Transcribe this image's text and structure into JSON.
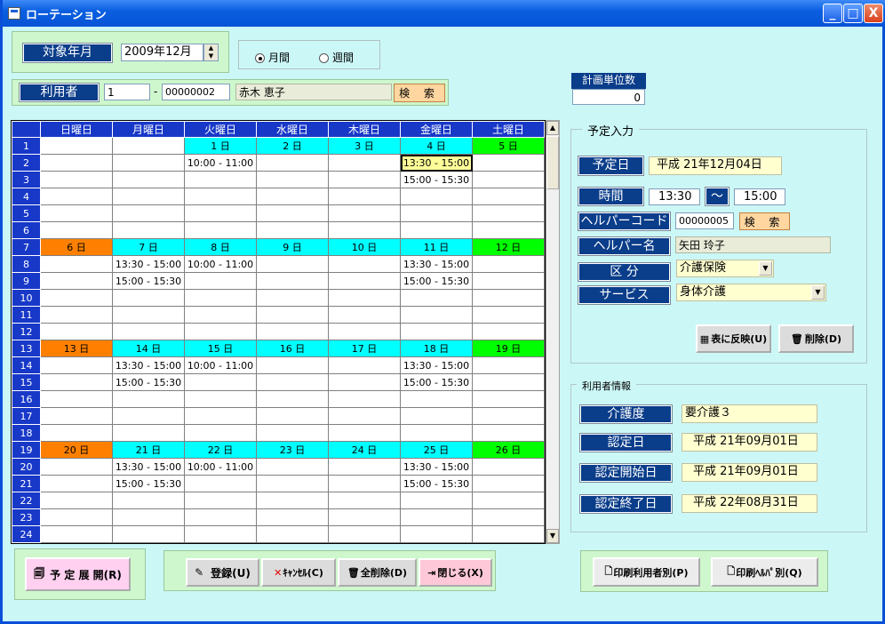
{
  "window": {
    "title": "ローテーション",
    "min": "_",
    "max": "□",
    "close": "X"
  },
  "header": {
    "target_label": "対象年月",
    "target_value": "2009年12月",
    "radio_month": "月間",
    "radio_week": "週間",
    "user_label": "利用者",
    "user_from": "1",
    "user_dash": "-",
    "user_to": "00000002",
    "user_name": "赤木 恵子",
    "search": "検 索",
    "plan_units_label": "計画単位数",
    "plan_units_value": "0"
  },
  "calendar": {
    "days": [
      "日曜日",
      "月曜日",
      "火曜日",
      "水曜日",
      "木曜日",
      "金曜日",
      "土曜日"
    ],
    "rows": [
      {
        "n": "1",
        "type": "date",
        "cells": [
          "",
          "",
          "1 日",
          "2 日",
          "3 日",
          "4 日",
          "5 日"
        ]
      },
      {
        "n": "2",
        "cells": [
          "",
          "",
          "10:00 - 11:00",
          "",
          "",
          "13:30 - 15:00",
          ""
        ]
      },
      {
        "n": "3",
        "cells": [
          "",
          "",
          "",
          "",
          "",
          "15:00 - 15:30",
          ""
        ]
      },
      {
        "n": "4",
        "cells": [
          "",
          "",
          "",
          "",
          "",
          "",
          ""
        ]
      },
      {
        "n": "5",
        "cells": [
          "",
          "",
          "",
          "",
          "",
          "",
          ""
        ]
      },
      {
        "n": "6",
        "cells": [
          "",
          "",
          "",
          "",
          "",
          "",
          ""
        ]
      },
      {
        "n": "7",
        "type": "date",
        "cells": [
          "6 日",
          "7 日",
          "8 日",
          "9 日",
          "10 日",
          "11 日",
          "12 日"
        ]
      },
      {
        "n": "8",
        "cells": [
          "",
          "13:30 - 15:00",
          "10:00 - 11:00",
          "",
          "",
          "13:30 - 15:00",
          ""
        ]
      },
      {
        "n": "9",
        "cells": [
          "",
          "15:00 - 15:30",
          "",
          "",
          "",
          "15:00 - 15:30",
          ""
        ]
      },
      {
        "n": "10",
        "cells": [
          "",
          "",
          "",
          "",
          "",
          "",
          ""
        ]
      },
      {
        "n": "11",
        "cells": [
          "",
          "",
          "",
          "",
          "",
          "",
          ""
        ]
      },
      {
        "n": "12",
        "cells": [
          "",
          "",
          "",
          "",
          "",
          "",
          ""
        ]
      },
      {
        "n": "13",
        "type": "date",
        "cells": [
          "13 日",
          "14 日",
          "15 日",
          "16 日",
          "17 日",
          "18 日",
          "19 日"
        ]
      },
      {
        "n": "14",
        "cells": [
          "",
          "13:30 - 15:00",
          "10:00 - 11:00",
          "",
          "",
          "13:30 - 15:00",
          ""
        ]
      },
      {
        "n": "15",
        "cells": [
          "",
          "15:00 - 15:30",
          "",
          "",
          "",
          "15:00 - 15:30",
          ""
        ]
      },
      {
        "n": "16",
        "cells": [
          "",
          "",
          "",
          "",
          "",
          "",
          ""
        ]
      },
      {
        "n": "17",
        "cells": [
          "",
          "",
          "",
          "",
          "",
          "",
          ""
        ]
      },
      {
        "n": "18",
        "cells": [
          "",
          "",
          "",
          "",
          "",
          "",
          ""
        ]
      },
      {
        "n": "19",
        "type": "date",
        "cells": [
          "20 日",
          "21 日",
          "22 日",
          "23 日",
          "24 日",
          "25 日",
          "26 日"
        ]
      },
      {
        "n": "20",
        "cells": [
          "",
          "13:30 - 15:00",
          "10:00 - 11:00",
          "",
          "",
          "13:30 - 15:00",
          ""
        ]
      },
      {
        "n": "21",
        "cells": [
          "",
          "15:00 - 15:30",
          "",
          "",
          "",
          "15:00 - 15:30",
          ""
        ]
      },
      {
        "n": "22",
        "cells": [
          "",
          "",
          "",
          "",
          "",
          "",
          ""
        ]
      },
      {
        "n": "23",
        "cells": [
          "",
          "",
          "",
          "",
          "",
          "",
          ""
        ]
      },
      {
        "n": "24",
        "cells": [
          "",
          "",
          "",
          "",
          "",
          "",
          ""
        ]
      }
    ]
  },
  "schedule": {
    "group_title": "予定入力",
    "date_label": "予定日",
    "date_value": "平成 21年12月04日",
    "time_label": "時間",
    "time_from": "13:30",
    "time_sep": "～",
    "time_to": "15:00",
    "helper_code_label": "ヘルパーコード",
    "helper_code": "00000005",
    "search": "検 索",
    "helper_name_label": "ヘルパー名",
    "helper_name": "矢田 玲子",
    "category_label": "区 分",
    "category_value": "介護保険",
    "service_label": "サービス",
    "service_value": "身体介護",
    "apply_button": "表に反映(U)",
    "delete_button": "削除(D)"
  },
  "user_info": {
    "group_title": "利用者情報",
    "care_level_label": "介護度",
    "care_level_value": "要介護３",
    "cert_date_label": "認定日",
    "cert_date_value": "平成 21年09月01日",
    "cert_start_label": "認定開始日",
    "cert_start_value": "平成 21年09月01日",
    "cert_end_label": "認定終了日",
    "cert_end_value": "平成 22年08月31日"
  },
  "footer": {
    "expand": "予 定 展 開(R)",
    "register": "登録(U)",
    "cancel": "ｷｬﾝｾﾙ(C)",
    "delete_all": "全削除(D)",
    "close": "閉じる(X)",
    "print_user": "印刷利用者別(P)",
    "print_helper": "印刷ﾍﾙﾊﾟ別(Q)"
  }
}
